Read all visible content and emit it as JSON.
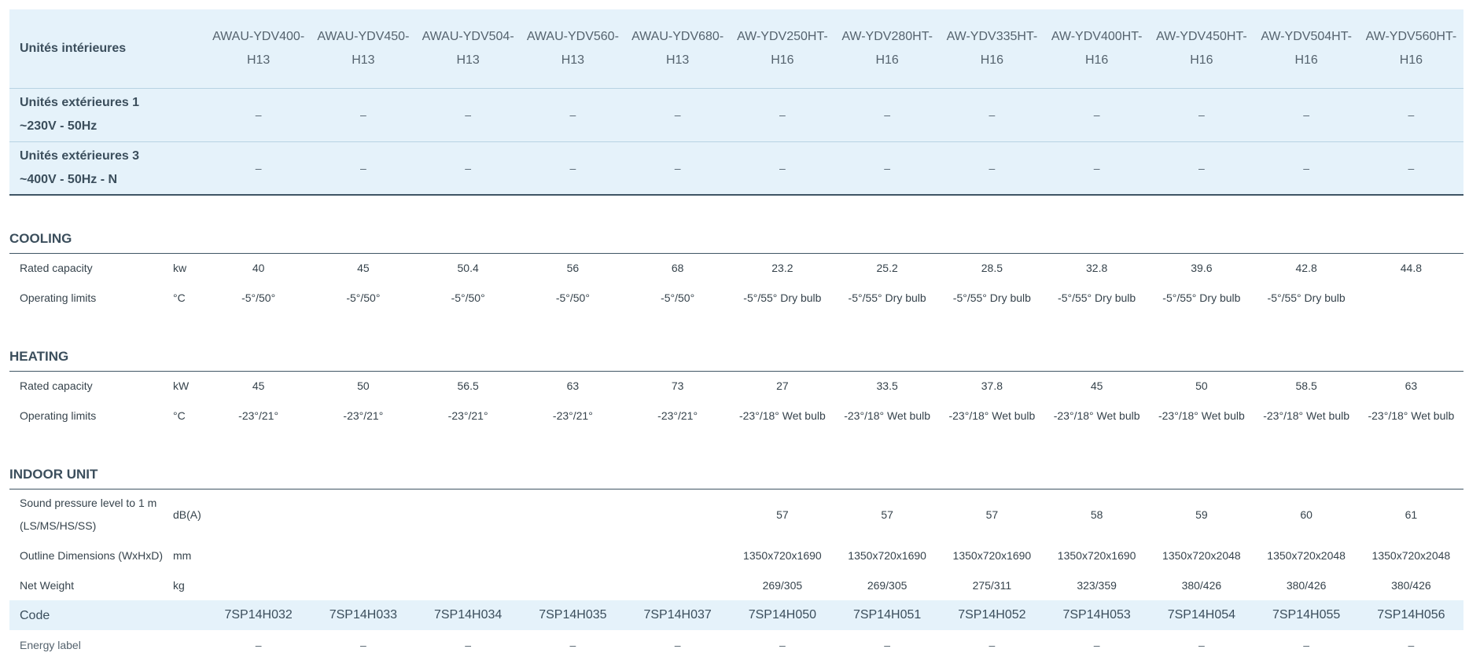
{
  "header": {
    "indoor_label": "Unités intérieures",
    "models": [
      "AWAU-YDV400-H13",
      "AWAU-YDV450-H13",
      "AWAU-YDV504-H13",
      "AWAU-YDV560-H13",
      "AWAU-YDV680-H13",
      "AW-YDV250HT-H16",
      "AW-YDV280HT-H16",
      "AW-YDV335HT-H16",
      "AW-YDV400HT-H16",
      "AW-YDV450HT-H16",
      "AW-YDV504HT-H16",
      "AW-YDV560HT-H16"
    ],
    "outdoor_1": {
      "label_line1": "Unités extérieures 1",
      "label_line2": "~230V - 50Hz",
      "values": [
        "–",
        "–",
        "–",
        "–",
        "–",
        "–",
        "–",
        "–",
        "–",
        "–",
        "–",
        "–"
      ]
    },
    "outdoor_3": {
      "label_line1": "Unités extérieures 3",
      "label_line2": "~400V - 50Hz - N",
      "values": [
        "–",
        "–",
        "–",
        "–",
        "–",
        "–",
        "–",
        "–",
        "–",
        "–",
        "–",
        "–"
      ]
    }
  },
  "sections": {
    "cooling": {
      "title": "COOLING",
      "rated_capacity": {
        "label": "Rated capacity",
        "unit": "kw",
        "values": [
          "40",
          "45",
          "50.4",
          "56",
          "68",
          "23.2",
          "25.2",
          "28.5",
          "32.8",
          "39.6",
          "42.8",
          "44.8"
        ]
      },
      "operating_limits": {
        "label": "Operating limits",
        "unit": "°C",
        "values": [
          "-5°/50°",
          "-5°/50°",
          "-5°/50°",
          "-5°/50°",
          "-5°/50°",
          "-5°/55° Dry bulb",
          "-5°/55° Dry bulb",
          "-5°/55° Dry bulb",
          "-5°/55° Dry bulb",
          "-5°/55° Dry bulb",
          "-5°/55° Dry bulb",
          ""
        ]
      }
    },
    "heating": {
      "title": "HEATING",
      "rated_capacity": {
        "label": "Rated capacity",
        "unit": "kW",
        "values": [
          "45",
          "50",
          "56.5",
          "63",
          "73",
          "27",
          "33.5",
          "37.8",
          "45",
          "50",
          "58.5",
          "63"
        ]
      },
      "operating_limits": {
        "label": "Operating limits",
        "unit": "°C",
        "values": [
          "-23°/21°",
          "-23°/21°",
          "-23°/21°",
          "-23°/21°",
          "-23°/21°",
          "-23°/18° Wet bulb",
          "-23°/18° Wet bulb",
          "-23°/18° Wet bulb",
          "-23°/18° Wet bulb",
          "-23°/18° Wet bulb",
          "-23°/18° Wet bulb",
          "-23°/18° Wet bulb"
        ]
      }
    },
    "indoor_unit": {
      "title": "INDOOR UNIT",
      "sound_pressure": {
        "label_line1": "Sound pressure level to 1 m",
        "label_line2": "(LS/MS/HS/SS)",
        "unit": "dB(A)",
        "values": [
          "",
          "",
          "",
          "",
          "",
          "57",
          "57",
          "57",
          "58",
          "59",
          "60",
          "61"
        ]
      },
      "dimensions": {
        "label": "Outline Dimensions (WxHxD)",
        "unit": "mm",
        "values": [
          "",
          "",
          "",
          "",
          "",
          "1350x720x1690",
          "1350x720x1690",
          "1350x720x1690",
          "1350x720x1690",
          "1350x720x2048",
          "1350x720x2048",
          "1350x720x2048"
        ]
      },
      "net_weight": {
        "label": "Net Weight",
        "unit": "kg",
        "values": [
          "",
          "",
          "",
          "",
          "",
          "269/305",
          "269/305",
          "275/311",
          "323/359",
          "380/426",
          "380/426",
          "380/426"
        ]
      }
    }
  },
  "code": {
    "label": "Code",
    "values": [
      "7SP14H032",
      "7SP14H033",
      "7SP14H034",
      "7SP14H035",
      "7SP14H037",
      "7SP14H050",
      "7SP14H051",
      "7SP14H052",
      "7SP14H053",
      "7SP14H054",
      "7SP14H055",
      "7SP14H056"
    ]
  },
  "energy_label": {
    "label": "Energy label",
    "values": [
      "–",
      "–",
      "–",
      "–",
      "–",
      "–",
      "–",
      "–",
      "–",
      "–",
      "–",
      "–"
    ]
  },
  "colors": {
    "header_bg": "#e5f2fa",
    "rule": "#3f5564",
    "text": "#2c3e4c"
  }
}
